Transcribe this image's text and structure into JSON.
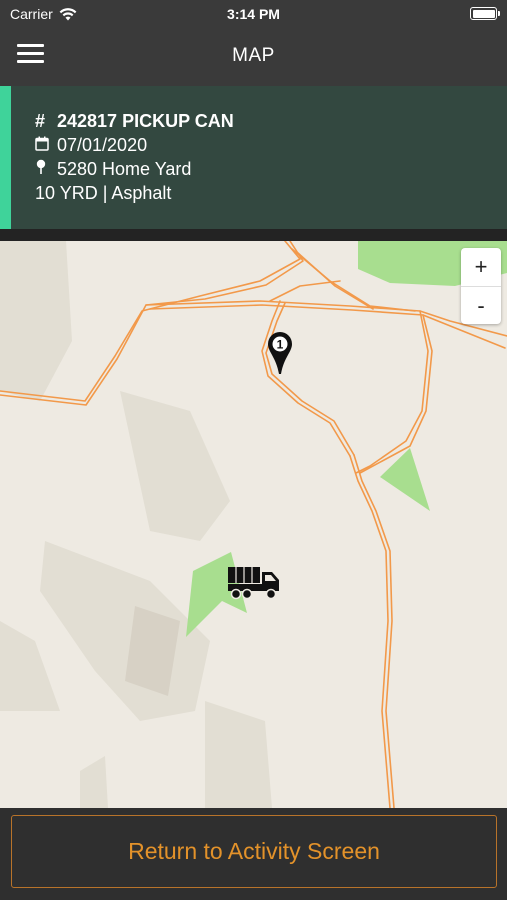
{
  "status_bar": {
    "carrier": "Carrier",
    "time": "3:14 PM"
  },
  "header": {
    "title": "MAP",
    "menu_icon": "hamburger-menu-icon"
  },
  "job": {
    "number_icon": "#",
    "title": "242817 PICKUP CAN",
    "date": "07/01/2020",
    "location": "5280 Home Yard",
    "details": "10 YRD | Asphalt",
    "accent_color": "#3fd39a",
    "background_color": "#334840"
  },
  "map": {
    "zoom_in_label": "+",
    "zoom_out_label": "-",
    "marker_label": "1",
    "road_color": "#f2994a",
    "park_color": "#a8de8f"
  },
  "footer": {
    "return_button_label": "Return to Activity Screen",
    "accent_color": "#e3922a"
  }
}
